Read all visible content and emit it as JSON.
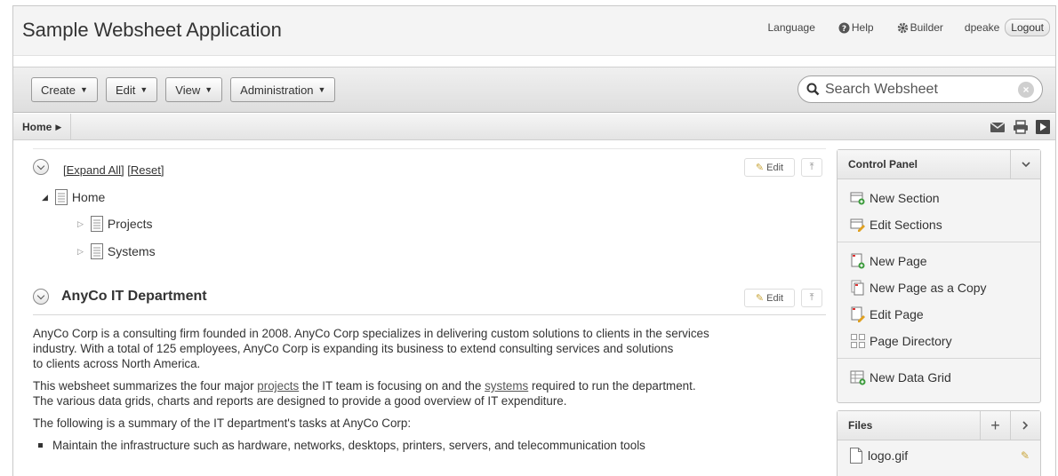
{
  "header": {
    "app_title": "Sample Websheet Application",
    "language_label": "Language",
    "help_label": "Help",
    "builder_label": "Builder",
    "username": "dpeake",
    "logout_label": "Logout"
  },
  "toolbar": {
    "menus": [
      {
        "label": "Create"
      },
      {
        "label": "Edit"
      },
      {
        "label": "View"
      },
      {
        "label": "Administration"
      }
    ],
    "search_placeholder": "Search Websheet"
  },
  "breadcrumb": {
    "home_label": "Home"
  },
  "navigation_section": {
    "expand_all_label": "[Expand All]",
    "reset_label": "[Reset]",
    "edit_label": "Edit",
    "tree": {
      "root": "Home",
      "children": [
        "Projects",
        "Systems"
      ]
    }
  },
  "content_section": {
    "title": "AnyCo IT Department",
    "edit_label": "Edit",
    "para1_line1": "AnyCo Corp is a consulting firm founded in 2008. AnyCo Corp specializes in delivering custom solutions to clients in the services",
    "para1_line2": "industry. With a total of 125 employees, AnyCo Corp is expanding its business to extend consulting services and solutions",
    "para1_line3": "to clients across North America.",
    "para2_before_projects": "This websheet summarizes the four major ",
    "para2_projects_link": "projects",
    "para2_middle": " the IT team is focusing on and the ",
    "para2_systems_link": "systems",
    "para2_after_systems": " required to run the department.",
    "para2_line2": "The various data grids, charts and reports are designed to provide a good overview of IT expenditure.",
    "para3": "The following is a summary of the IT department's tasks at AnyCo Corp:",
    "bullet1": "Maintain the infrastructure such as hardware, networks, desktops, printers, servers, and telecommunication tools"
  },
  "control_panel": {
    "title": "Control Panel",
    "group1": [
      "New Section",
      "Edit Sections"
    ],
    "group2": [
      "New Page",
      "New Page as a Copy",
      "Edit Page",
      "Page Directory"
    ],
    "group3": [
      "New Data Grid"
    ]
  },
  "files_panel": {
    "title": "Files",
    "items": [
      "logo.gif"
    ]
  }
}
